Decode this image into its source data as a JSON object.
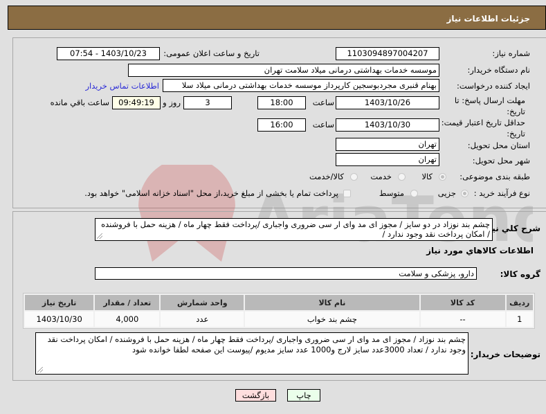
{
  "header": {
    "title": "جزئیات اطلاعات نیاز"
  },
  "form": {
    "need_number": {
      "label": "شماره نیاز:",
      "value": "1103094897004207"
    },
    "announce_datetime": {
      "label": "تاریخ و ساعت اعلان عمومی:",
      "value": "1403/10/23 - 07:54"
    },
    "buyer_org": {
      "label": "نام دستگاه خریدار:",
      "value": "موسسه خدمات بهداشتی درمانی میلاد سلامت تهران"
    },
    "requester": {
      "label": "ایجاد کننده درخواست:",
      "value": "بهنام قنبری مجردبوسجین کارپرداز موسسه خدمات بهداشتی درمانی میلاد سلا",
      "contact_link": "اطلاعات تماس خریدار"
    },
    "reply_deadline": {
      "label_line1": "مهلت ارسال پاسخ: تا",
      "label_line2": "تاریخ:",
      "date": "1403/10/26",
      "time_label": "ساعت",
      "time": "18:00",
      "days": "3",
      "days_label": "روز و",
      "remaining": "09:49:19",
      "remaining_label": "ساعت باقي مانده"
    },
    "price_validity": {
      "label_line1": "حداقل تاریخ اعتبار قیمت: تا",
      "label_line2": "تاریخ:",
      "date": "1403/10/30",
      "time_label": "ساعت",
      "time": "16:00"
    },
    "province": {
      "label": "استان محل تحویل:",
      "value": "تهران"
    },
    "city": {
      "label": "شهر محل تحویل:",
      "value": "تهران"
    },
    "category": {
      "label": "طبقه بندی موضوعی:",
      "options": [
        "کالا",
        "خدمت",
        "کالا/خدمت"
      ],
      "selected": "کالا"
    },
    "process_type": {
      "label": "نوع فرآیند خرید :",
      "options": [
        "جزیی",
        "متوسط"
      ],
      "selected": "جزیی",
      "treasury_note": "پرداخت تمام یا بخشی از مبلغ خرید،از محل \"اسناد خزانه اسلامی\" خواهد بود."
    }
  },
  "summary": {
    "label": "شرح کلي نياز:",
    "text": "چشم بند نوزاد  در دو سایز / مجوز ای مد  وای ار سی ضروری واجباری /پرداخت فقط چهار ماه / هزینه حمل با فروشنده / امکان پرداخت نقد وجود ندارد /"
  },
  "goods": {
    "section_title": "اطلاعات کالاهاي مورد نياز",
    "group_label": "گروه کالا:",
    "group_value": "دارو، پزشکی و سلامت",
    "columns": [
      "ردیف",
      "کد کالا",
      "نام کالا",
      "واحد شمارش",
      "تعداد / مقدار",
      "تاریخ نیاز"
    ],
    "rows": [
      {
        "row": "1",
        "code": "--",
        "name": "چشم بند خواب",
        "unit": "عدد",
        "qty": "4,000",
        "date": "1403/10/30"
      }
    ]
  },
  "buyer_notes": {
    "label": "توضیحات خریدار:",
    "text": "چشم بند نوزاد / مجوز ای مد  وای ار سی ضروری واجباری /پرداخت فقط چهار ماه / هزینه حمل با فروشنده / امکان پرداخت نقد وجود ندارد / تعداد 3000عدد سایز  لارج و1000 عدد سایز مدیوم /پیوست این صفحه لطفا خوانده شود"
  },
  "buttons": {
    "print": "چاپ",
    "back": "بازگشت"
  },
  "colors": {
    "header_bg": "#8b6d43",
    "link": "#2929d6",
    "print_bg": "#eaffea",
    "back_bg": "#ffdede"
  }
}
